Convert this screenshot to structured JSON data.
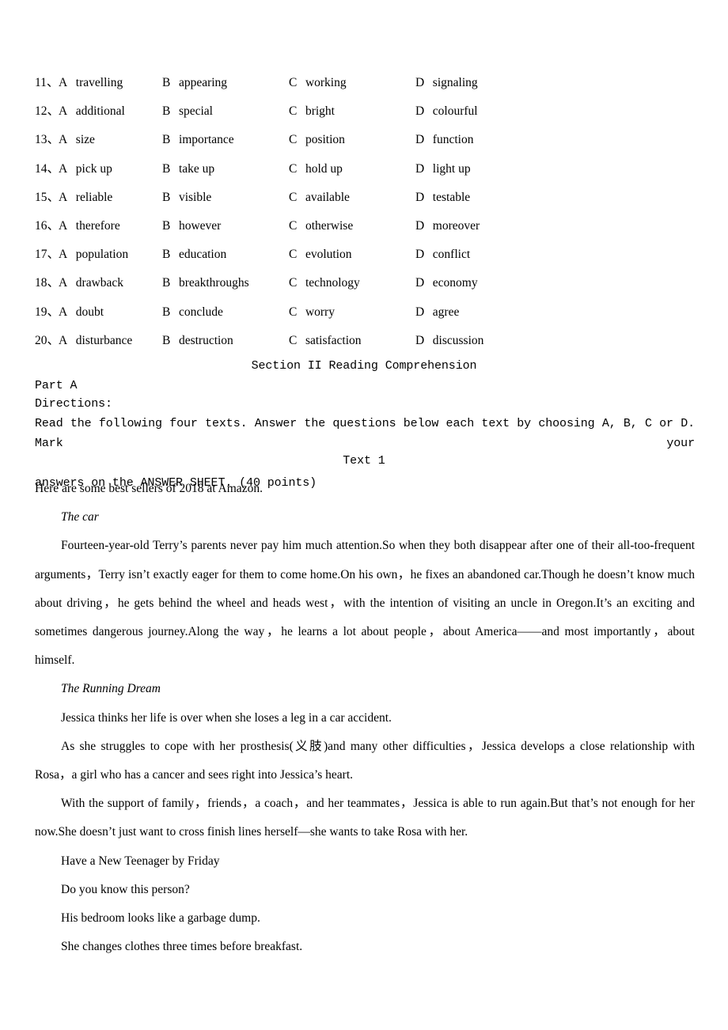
{
  "mcq": {
    "columns": [
      "A",
      "B",
      "C",
      "D"
    ],
    "rows": [
      {
        "number": "11、",
        "options": [
          "travelling",
          "appearing",
          "working",
          "signaling"
        ]
      },
      {
        "number": "12、",
        "options": [
          "additional",
          "special",
          "bright",
          "colourful"
        ]
      },
      {
        "number": "13、",
        "options": [
          "size",
          "importance",
          "position",
          "function"
        ]
      },
      {
        "number": "14、",
        "options": [
          "pick up",
          "take up",
          "hold up",
          "light up"
        ]
      },
      {
        "number": "15、",
        "options": [
          "reliable",
          "visible",
          "available",
          "testable"
        ]
      },
      {
        "number": "16、",
        "options": [
          "therefore",
          "however",
          "otherwise",
          "moreover"
        ]
      },
      {
        "number": "17、",
        "options": [
          "population",
          "education",
          "evolution",
          "conflict"
        ]
      },
      {
        "number": "18、",
        "options": [
          "drawback",
          "breakthroughs",
          "technology",
          "economy"
        ]
      },
      {
        "number": "19、",
        "options": [
          "doubt",
          "conclude",
          "worry",
          "agree"
        ]
      },
      {
        "number": "20、",
        "options": [
          "disturbance",
          "destruction",
          "satisfaction",
          "discussion"
        ]
      }
    ]
  },
  "section": {
    "heading": "Section II Reading Comprehension",
    "part_label": "Part A",
    "directions_label": "Directions:",
    "directions_line1": "Read the following four texts. Answer the questions below each text by choosing A, B, C or D. Mark your",
    "directions_line2": "answers on the ANSWER SHEET. (40 points)",
    "text_heading": "Text 1"
  },
  "passage": {
    "intro": "Here are some best sellers of 2018 at Amazon.",
    "book1_title": "The car",
    "book1_para": "Fourteen-year-old Terry’s parents never pay him much attention.So when they both disappear after one of their all-too-frequent arguments，Terry isn’t exactly eager for them to come home.On his own，he fixes an abandoned car.Though he doesn’t know much about driving，he gets behind the wheel and heads west，with the intention of visiting an uncle in Oregon.It’s an exciting and sometimes dangerous journey.Along the way，he learns a lot about people，about America——and most importantly，about himself.",
    "book2_title": "The Running Dream",
    "book2_para1": "Jessica thinks her life is over when she loses a leg in a car accident.",
    "book2_para2": "As she struggles to cope with her prosthesis(义肢)and many other difficulties，Jessica develops a close relationship with Rosa，a girl who has a cancer and sees right into Jessica’s heart.",
    "book2_para3": "With the support of family，friends，a coach，and her teammates，Jessica is able to run again.But that’s not enough for her now.She doesn’t just want to cross finish lines herself—she wants to take Rosa with her.",
    "book3_title": "Have a New Teenager by Friday",
    "book3_line1": "Do you know this person?",
    "book3_line2": "His bedroom looks like a garbage dump.",
    "book3_line3": "She changes clothes three times before breakfast."
  }
}
